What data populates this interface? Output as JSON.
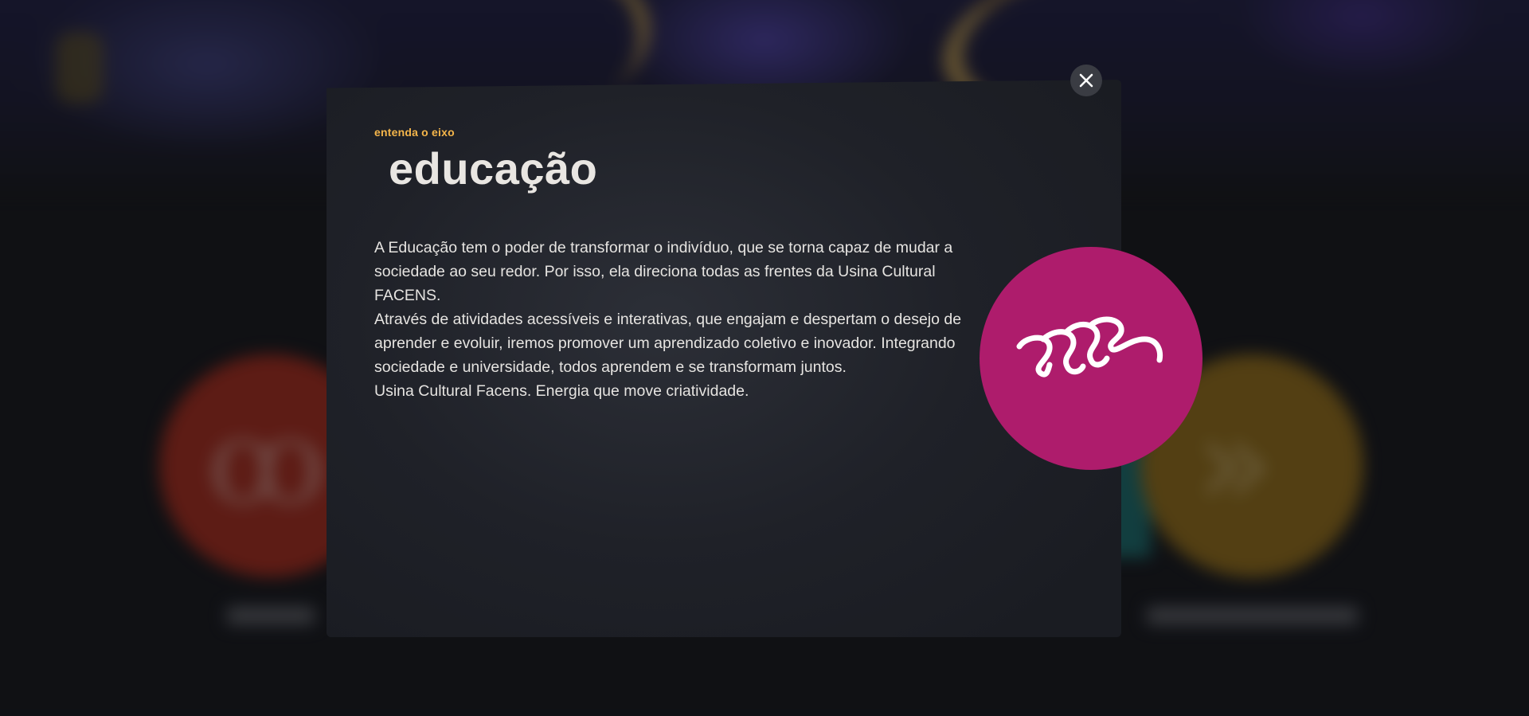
{
  "modal": {
    "eyebrow": "entenda o eixo",
    "title": "educação",
    "paragraphs": [
      "A Educação tem o poder de transformar o indivíduo, que se torna capaz de mudar a sociedade ao seu redor. Por isso, ela direciona todas as frentes da Usina Cultural FACENS.",
      "Através de atividades acessíveis e interativas, que engajam e despertam o desejo de aprender e evoluir, iremos promover um aprendizado coletivo e inovador. Integrando sociedade e universidade, todos aprendem e se transformam juntos.",
      "Usina Cultural Facens. Energia que move criatividade."
    ],
    "emblem_icon": "education-wave-icon",
    "emblem_color": "#ae1c6c",
    "close_icon": "close-icon"
  },
  "colors": {
    "accent": "#f4b54a",
    "title": "#e9e6e2",
    "modal_bg": "#1f2128",
    "bg_circle_left": "#a12a1c",
    "bg_circle_right": "#8e6a18"
  }
}
